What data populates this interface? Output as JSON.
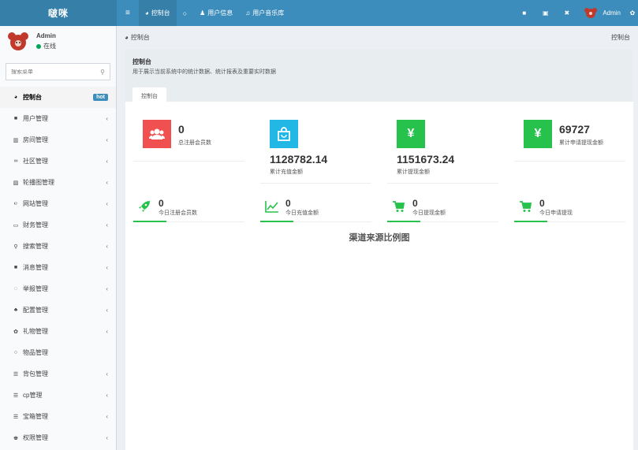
{
  "app": {
    "logo": "啵咪"
  },
  "topnav": {
    "items": [
      {
        "label": "控制台"
      },
      {
        "label": ""
      },
      {
        "label": "用户信息"
      },
      {
        "label": "用户音乐库"
      }
    ],
    "user": "Admin"
  },
  "sidebar": {
    "user_name": "Admin",
    "user_status": "在线",
    "search_placeholder": "搜索菜单",
    "items": [
      {
        "label": "控制台",
        "badge": "hot"
      },
      {
        "label": "用户管理"
      },
      {
        "label": "房间管理"
      },
      {
        "label": "社区管理"
      },
      {
        "label": "轮播图管理"
      },
      {
        "label": "网站管理"
      },
      {
        "label": "财务管理"
      },
      {
        "label": "搜索管理"
      },
      {
        "label": "消息管理"
      },
      {
        "label": "举报管理"
      },
      {
        "label": "配置管理"
      },
      {
        "label": "礼物管理"
      },
      {
        "label": "物品管理"
      },
      {
        "label": "背包管理"
      },
      {
        "label": "cp管理"
      },
      {
        "label": "宝箱管理"
      },
      {
        "label": "权限管理"
      }
    ]
  },
  "breadcrumb": {
    "left": "控制台",
    "right": "控制台"
  },
  "panel": {
    "title": "控制台",
    "description": "用于展示当前系统中的统计数据、统计报表及重要实时数据",
    "tab": "控制台"
  },
  "stats": [
    {
      "value": "0",
      "label": "总注册会员数"
    },
    {
      "value": "1128782.14",
      "label": "累计充值金额"
    },
    {
      "value": "1151673.24",
      "label": "累计提现金额"
    },
    {
      "value": "69727",
      "label": "累计申请提现金额"
    }
  ],
  "today_stats": [
    {
      "value": "0",
      "label": "今日注册会员数"
    },
    {
      "value": "0",
      "label": "今日充值金额"
    },
    {
      "value": "0",
      "label": "今日提现金额"
    },
    {
      "value": "0",
      "label": "今日申请提现"
    }
  ],
  "chart_title": "渠道来源比例图",
  "colors": {
    "primary": "#3c8dbc",
    "red": "#f05050",
    "cyan": "#23b7e5",
    "green": "#27c24c"
  }
}
